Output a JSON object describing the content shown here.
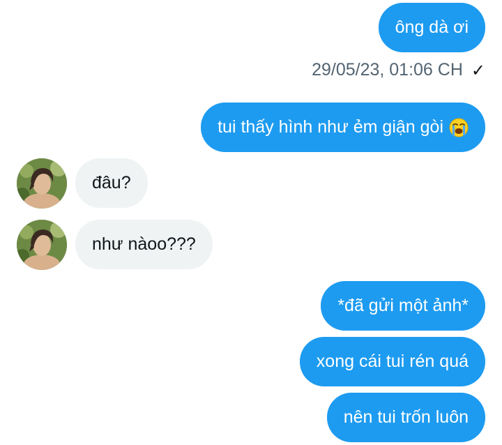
{
  "messages": [
    {
      "sender": "me",
      "text": "ông dà ơi"
    },
    {
      "sender": "me",
      "text": "tui thấy hình như ẻm giận gòi",
      "emoji": "loudly-crying-face-icon"
    },
    {
      "sender": "them",
      "text": "đâu?"
    },
    {
      "sender": "them",
      "text": "như nàoo???"
    },
    {
      "sender": "me",
      "text": "*đã gửi một ảnh*"
    },
    {
      "sender": "me",
      "text": "xong cái tui rén quá"
    },
    {
      "sender": "me",
      "text": "nên tui trốn luôn"
    }
  ],
  "timestamp": "29/05/23, 01:06 CH",
  "status_icon": "check-icon",
  "colors": {
    "outgoing_bubble": "#1d9bf0",
    "incoming_bubble": "#eff3f4",
    "timestamp": "#536471"
  }
}
